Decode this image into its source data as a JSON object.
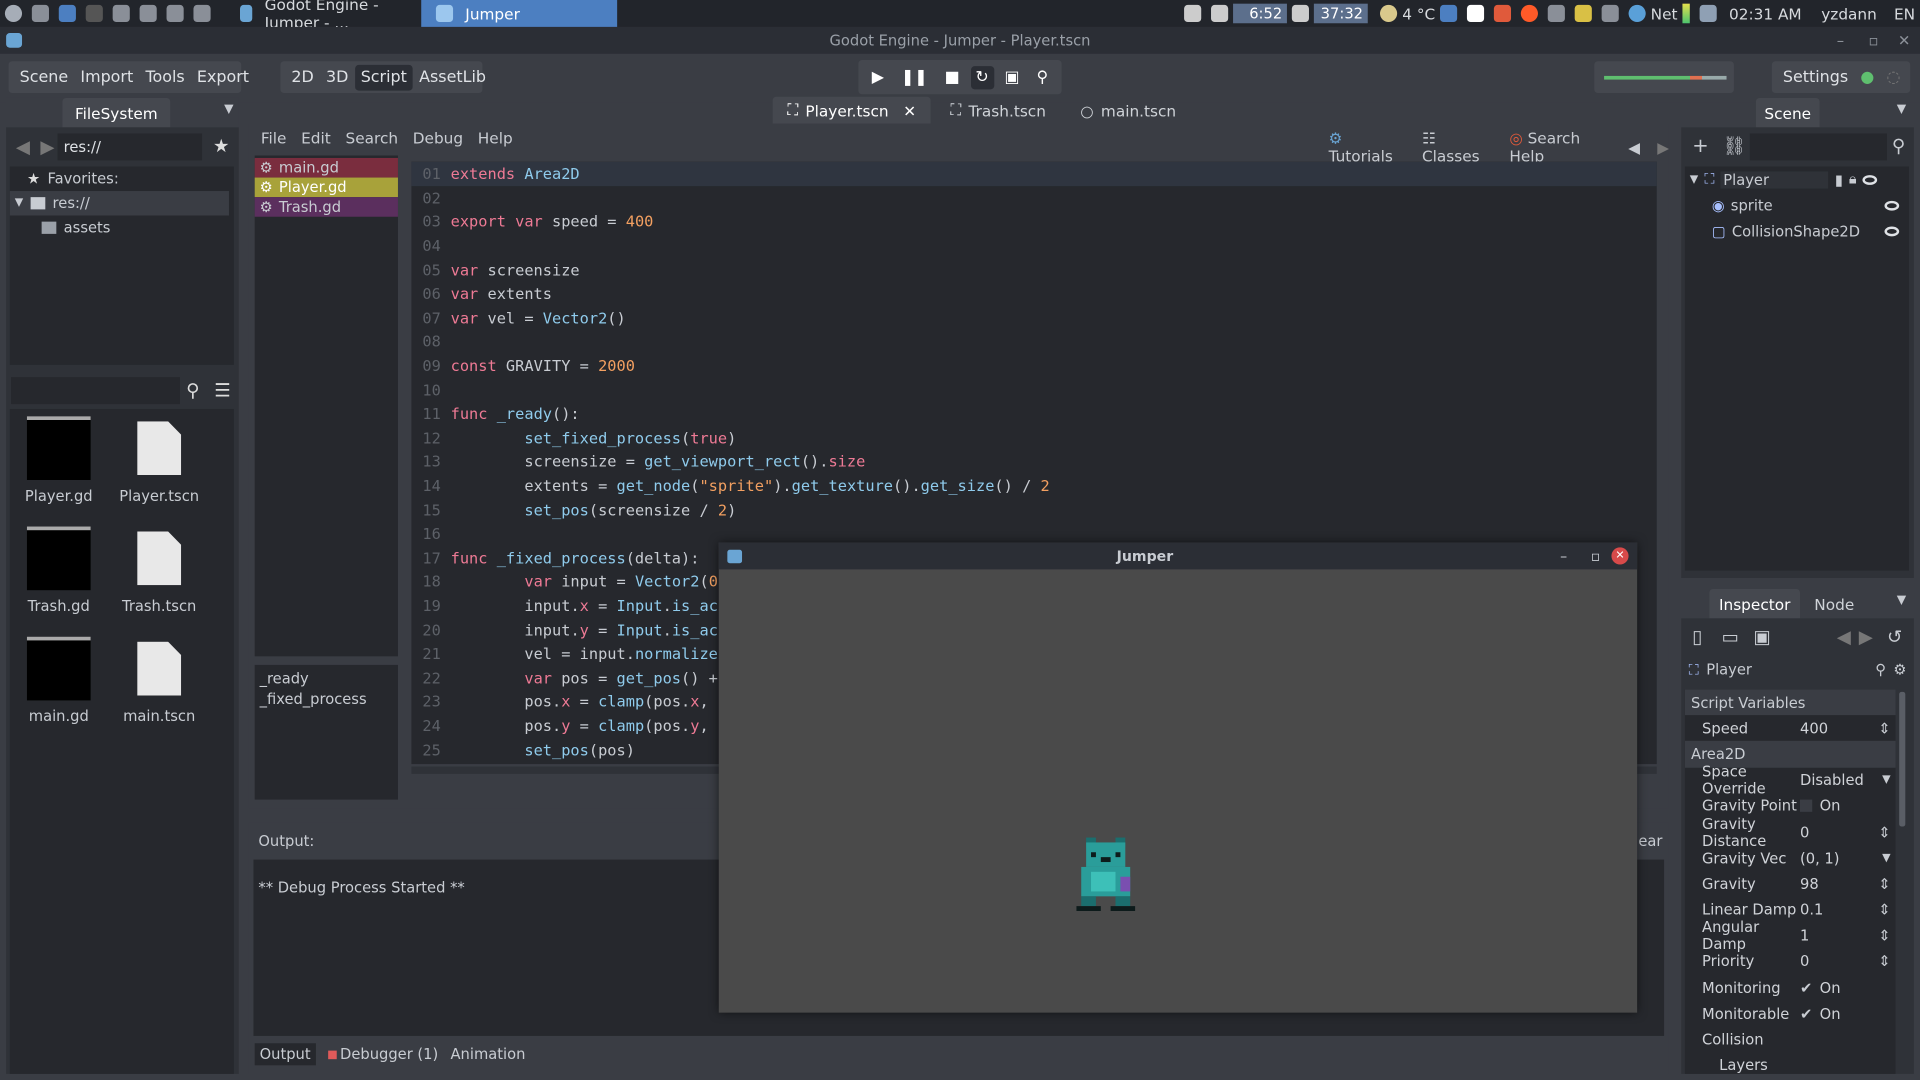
{
  "taskbar": {
    "tasks": [
      {
        "label": "Godot Engine - Jumper - ..."
      },
      {
        "label": "Jumper"
      }
    ],
    "cpu_time": "6:52",
    "mem": "37:32",
    "weather": "4 °C",
    "net": "Net",
    "clock": "02:31 AM",
    "user": "yzdann",
    "lang": "EN"
  },
  "window_title": "Godot Engine - Jumper - Player.tscn",
  "menu": {
    "items": [
      "Scene",
      "Import",
      "Tools",
      "Export"
    ],
    "modes": [
      "2D",
      "3D",
      "Script",
      "AssetLib"
    ],
    "active_mode": "Script",
    "settings": "Settings"
  },
  "filesystem": {
    "title": "FileSystem",
    "path": "res://",
    "favorites": "Favorites:",
    "tree": [
      "res://",
      "assets"
    ],
    "files": [
      "Player.gd",
      "Player.tscn",
      "Trash.gd",
      "Trash.tscn",
      "main.gd",
      "main.tscn"
    ]
  },
  "scene_tabs": [
    "Player.tscn",
    "Trash.tscn",
    "main.tscn"
  ],
  "script_menu": {
    "items": [
      "File",
      "Edit",
      "Search",
      "Debug",
      "Help"
    ],
    "help": [
      "Tutorials",
      "Classes",
      "Search Help"
    ]
  },
  "script_list": {
    "files": [
      "main.gd",
      "Player.gd",
      "Trash.gd"
    ],
    "colors": [
      "#7a2d3e",
      "#a8a23a",
      "#5b2f5e"
    ],
    "methods": [
      "_ready",
      "_fixed_process"
    ]
  },
  "code_lines": [
    {
      "n": "01",
      "t": "extends Area2D"
    },
    {
      "n": "02",
      "t": ""
    },
    {
      "n": "03",
      "t": "export var speed = 400"
    },
    {
      "n": "04",
      "t": ""
    },
    {
      "n": "05",
      "t": "var screensize"
    },
    {
      "n": "06",
      "t": "var extents"
    },
    {
      "n": "07",
      "t": "var vel = Vector2()"
    },
    {
      "n": "08",
      "t": ""
    },
    {
      "n": "09",
      "t": "const GRAVITY = 2000"
    },
    {
      "n": "10",
      "t": ""
    },
    {
      "n": "11",
      "t": "func _ready():"
    },
    {
      "n": "12",
      "t": "\tset_fixed_process(true)"
    },
    {
      "n": "13",
      "t": "\tscreensize = get_viewport_rect().size"
    },
    {
      "n": "14",
      "t": "\textents = get_node(\"sprite\").get_texture().get_size() / 2"
    },
    {
      "n": "15",
      "t": "\tset_pos(screensize / 2)"
    },
    {
      "n": "16",
      "t": ""
    },
    {
      "n": "17",
      "t": "func _fixed_process(delta):"
    },
    {
      "n": "18",
      "t": "\tvar input = Vector2(0"
    },
    {
      "n": "19",
      "t": "\tinput.x = Input.is_ac"
    },
    {
      "n": "20",
      "t": "\tinput.y = Input.is_ac"
    },
    {
      "n": "21",
      "t": "\tvel = input.normalize"
    },
    {
      "n": "22",
      "t": "\tvar pos = get_pos() +"
    },
    {
      "n": "23",
      "t": "\tpos.x = clamp(pos.x,"
    },
    {
      "n": "24",
      "t": "\tpos.y = clamp(pos.y,"
    },
    {
      "n": "25",
      "t": "\tset_pos(pos)"
    }
  ],
  "output": {
    "title": "Output:",
    "clear": "ear",
    "text": "** Debug Process Started **",
    "tabs": [
      "Output",
      "Debugger (1)",
      "Animation"
    ]
  },
  "scene_panel": {
    "title": "Scene",
    "nodes": [
      "Player",
      "sprite",
      "CollisionShape2D"
    ]
  },
  "inspector": {
    "tabs": [
      "Inspector",
      "Node"
    ],
    "object": "Player",
    "sections": [
      "Script Variables",
      "Area2D"
    ],
    "rows": [
      {
        "label": "Speed",
        "value": "400"
      },
      {
        "label": "Space Override",
        "value": "Disabled"
      },
      {
        "label": "Gravity Point",
        "value": "On"
      },
      {
        "label": "Gravity Distance",
        "value": "0"
      },
      {
        "label": "Gravity Vec",
        "value": "(0, 1)"
      },
      {
        "label": "Gravity",
        "value": "98"
      },
      {
        "label": "Linear Damp",
        "value": "0.1"
      },
      {
        "label": "Angular Damp",
        "value": "1"
      },
      {
        "label": "Priority",
        "value": "0"
      },
      {
        "label": "Monitoring",
        "value": "On"
      },
      {
        "label": "Monitorable",
        "value": "On"
      },
      {
        "label": "Collision",
        "value": ""
      },
      {
        "label": "Layers",
        "value": ""
      }
    ]
  },
  "game_window": {
    "title": "Jumper"
  }
}
